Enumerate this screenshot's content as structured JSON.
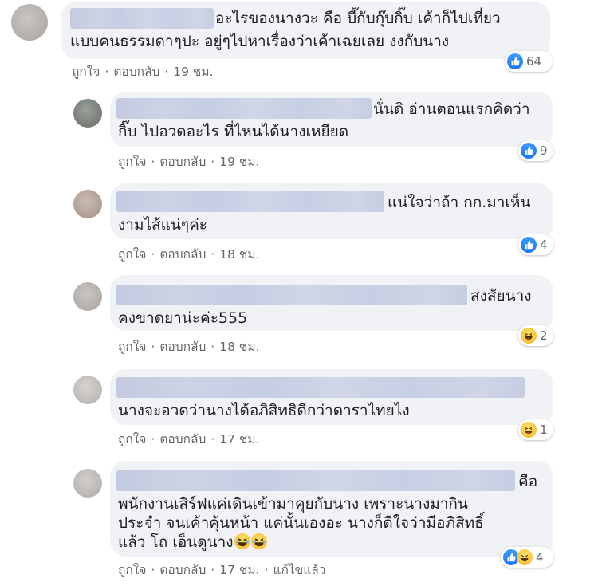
{
  "comments": [
    {
      "lines": [
        "อะไรของนางวะ คือ บี๊กับกุ๊บกิ๊บ เค้าก็ไปเที่ยว",
        "แบบคนธรรมดาๆปะ อยู่ๆไปหาเรื่องว่าเค้าเฉยเลย งงกับนาง"
      ],
      "actions": {
        "like": "ถูกใจ",
        "reply": "ตอบกลับ",
        "time": "19 ชม."
      },
      "reaction": {
        "type": "like-icon",
        "count": "64"
      }
    },
    {
      "lines": [
        "นั่นดิ อ่านตอนแรกคิดว่า",
        "กิ๊บ ไปอวดอะไร ที่ไหนได้นางเหยียด"
      ],
      "actions": {
        "like": "ถูกใจ",
        "reply": "ตอบกลับ",
        "time": "19 ชม."
      },
      "reaction": {
        "type": "like-icon",
        "count": "9"
      }
    },
    {
      "lines": [
        "แน่ใจว่าถ้า กก.มาเห็น",
        "งามไส้แน่ๆค่ะ"
      ],
      "actions": {
        "like": "ถูกใจ",
        "reply": "ตอบกลับ",
        "time": "18 ชม."
      },
      "reaction": {
        "type": "like-icon",
        "count": "4"
      }
    },
    {
      "lines": [
        "สงสัยนาง",
        "คงขาดยาน่ะค่ะ555"
      ],
      "actions": {
        "like": "ถูกใจ",
        "reply": "ตอบกลับ",
        "time": "18 ชม."
      },
      "reaction": {
        "type": "haha-icon",
        "count": "2"
      }
    },
    {
      "lines": [
        "นางจะอวดว่านางได้อภิสิทธิดีกว่าดาราไทยไง"
      ],
      "actions": {
        "like": "ถูกใจ",
        "reply": "ตอบกลับ",
        "time": "17 ชม."
      },
      "reaction": {
        "type": "haha-icon",
        "count": "1"
      }
    },
    {
      "lines": [
        "คือ",
        "พนักงานเสิร์ฟแค่เดินเข้ามาคุยกับนาง เพราะนางมากิน",
        "ประจำ จนเค้าคุ้นหน้า แค่นั้นเองอะ นางก็ดีใจว่ามีอภิสิทธิ์",
        "แล้ว โถ เอ็นดูนาง"
      ],
      "actions": {
        "like": "ถูกใจ",
        "reply": "ตอบกลับ",
        "time": "17 ชม.",
        "edited": "แก้ไขแล้ว"
      },
      "reaction": {
        "type": "like-icon haha-icon",
        "count": "4"
      }
    }
  ]
}
